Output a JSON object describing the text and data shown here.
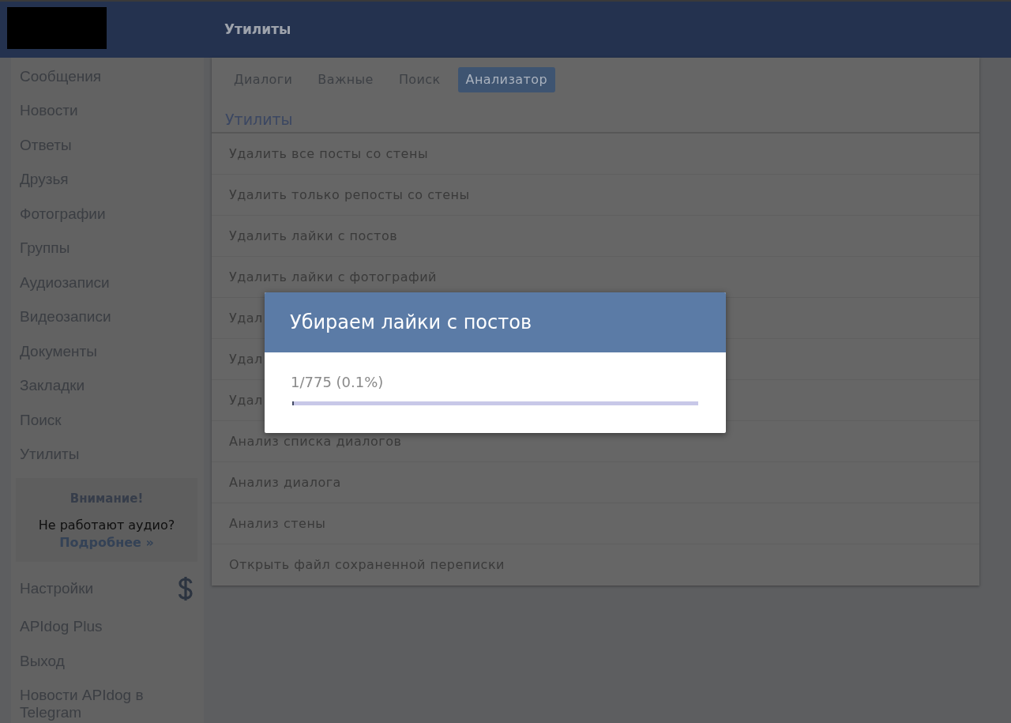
{
  "header": {
    "title": "Утилиты"
  },
  "sidebar": {
    "items": [
      {
        "kind": "link",
        "label": "Сообщения"
      },
      {
        "kind": "link",
        "label": "Новости"
      },
      {
        "kind": "link",
        "label": "Ответы"
      },
      {
        "kind": "link",
        "label": "Друзья"
      },
      {
        "kind": "link",
        "label": "Фотографии"
      },
      {
        "kind": "link",
        "label": "Группы"
      },
      {
        "kind": "link",
        "label": "Аудиозаписи"
      },
      {
        "kind": "link",
        "label": "Видеозаписи"
      },
      {
        "kind": "link",
        "label": "Документы"
      },
      {
        "kind": "link",
        "label": "Закладки"
      },
      {
        "kind": "link",
        "label": "Поиск"
      },
      {
        "kind": "link",
        "label": "Утилиты"
      },
      {
        "kind": "notice",
        "title": "Внимание!",
        "text": "Не работают аудио?",
        "link": "Подробнее »"
      },
      {
        "kind": "link_icon",
        "label": "Настройки"
      },
      {
        "kind": "link",
        "label": "APIdog Plus"
      },
      {
        "kind": "link",
        "label": "Выход"
      },
      {
        "kind": "link",
        "label": "Новости APIdog в Telegram"
      }
    ]
  },
  "main": {
    "tabs": [
      {
        "label": "Диалоги",
        "selected": false
      },
      {
        "label": "Важные",
        "selected": false
      },
      {
        "label": "Поиск",
        "selected": false
      },
      {
        "label": "Анализатор",
        "selected": true
      }
    ],
    "section_title": "Утилиты",
    "actions": [
      "Удалить все посты со стены",
      "Удалить только репосты со стены",
      "Удалить лайки с постов",
      "Удалить лайки с фотографий",
      "Удал",
      "Удал",
      "Удал",
      "Анализ списка диалогов",
      "Анализ диалога",
      "Анализ стены",
      "Открыть файл сохраненной переписки"
    ]
  },
  "modal": {
    "title": "Убираем лайки с постов",
    "progress_text": "1/775 (0.1%)",
    "level": 0.0013
  }
}
